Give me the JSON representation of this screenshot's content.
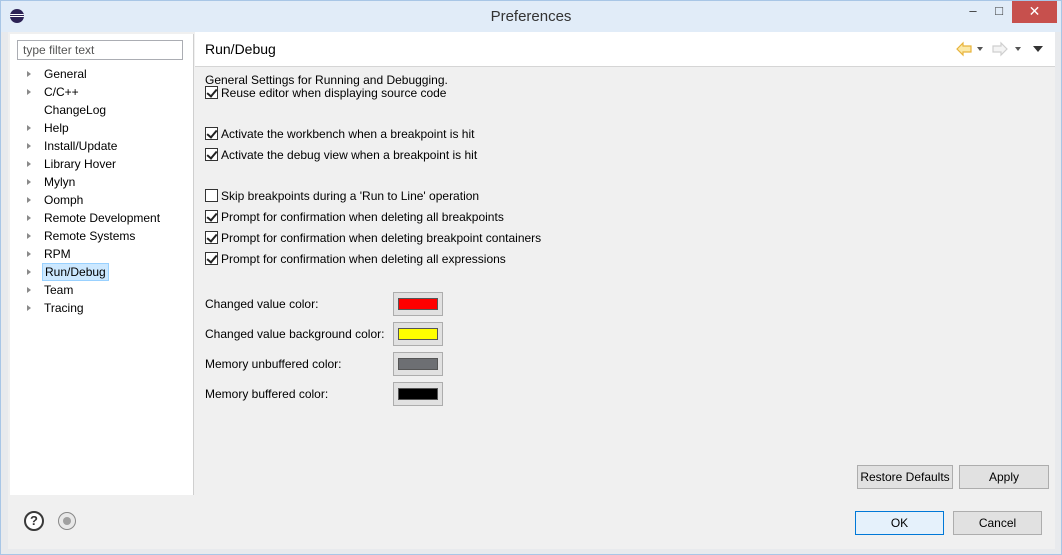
{
  "window": {
    "title": "Preferences",
    "minimize_glyph": "–",
    "maximize_glyph": "□",
    "close_glyph": "✕"
  },
  "sidebar": {
    "filter_placeholder": "type filter text",
    "items": [
      {
        "label": "General",
        "expandable": true
      },
      {
        "label": "C/C++",
        "expandable": true
      },
      {
        "label": "ChangeLog",
        "expandable": false
      },
      {
        "label": "Help",
        "expandable": true
      },
      {
        "label": "Install/Update",
        "expandable": true
      },
      {
        "label": "Library Hover",
        "expandable": true
      },
      {
        "label": "Mylyn",
        "expandable": true
      },
      {
        "label": "Oomph",
        "expandable": true
      },
      {
        "label": "Remote Development",
        "expandable": true
      },
      {
        "label": "Remote Systems",
        "expandable": true
      },
      {
        "label": "RPM",
        "expandable": true
      },
      {
        "label": "Run/Debug",
        "expandable": true,
        "selected": true
      },
      {
        "label": "Team",
        "expandable": true
      },
      {
        "label": "Tracing",
        "expandable": true
      }
    ]
  },
  "page": {
    "title": "Run/Debug",
    "intro": "General Settings for Running and Debugging.",
    "checkboxes": [
      {
        "label": "Reuse editor when displaying source code",
        "checked": true
      },
      {
        "label": "Activate the workbench when a breakpoint is hit",
        "checked": true
      },
      {
        "label": "Activate the debug view when a breakpoint is hit",
        "checked": true
      },
      {
        "label": "Skip breakpoints during a 'Run to Line' operation",
        "checked": false
      },
      {
        "label": "Prompt for confirmation when deleting all breakpoints",
        "checked": true
      },
      {
        "label": "Prompt for confirmation when deleting breakpoint containers",
        "checked": true
      },
      {
        "label": "Prompt for confirmation when deleting all expressions",
        "checked": true
      }
    ],
    "colors": [
      {
        "label": "Changed value color:",
        "color": "#ff0000"
      },
      {
        "label": "Changed value background color:",
        "color": "#ffff00"
      },
      {
        "label": "Memory unbuffered color:",
        "color": "#6d6f73"
      },
      {
        "label": "Memory buffered color:",
        "color": "#000000"
      }
    ],
    "restore_defaults_label": "Restore Defaults",
    "apply_label": "Apply",
    "nav_icons": [
      "back-arrow-icon",
      "forward-arrow-icon",
      "view-menu-icon"
    ]
  },
  "footer": {
    "help_glyph": "?",
    "ok_label": "OK",
    "cancel_label": "Cancel"
  },
  "theme": {
    "accent": "#0078d7",
    "back_arrow_color": "#e8b33c",
    "forward_arrow_color": "#cfcfcf"
  }
}
